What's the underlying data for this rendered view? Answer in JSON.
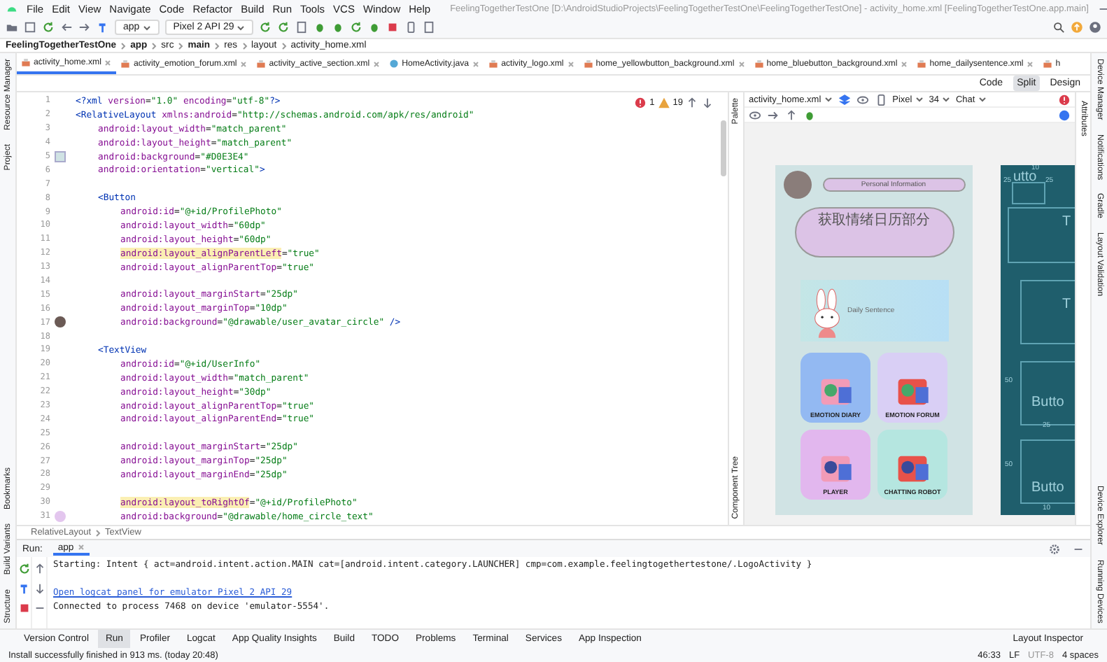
{
  "menu_bar": {
    "items": [
      "File",
      "Edit",
      "View",
      "Navigate",
      "Code",
      "Refactor",
      "Build",
      "Run",
      "Tools",
      "VCS",
      "Window",
      "Help"
    ],
    "title": "FeelingTogetherTestOne [D:\\AndroidStudioProjects\\FeelingTogetherTestOne\\FeelingTogetherTestOne] - activity_home.xml [FeelingTogetherTestOne.app.main]"
  },
  "toolbar": {
    "run_config": "app",
    "device": "Pixel 2 API 29"
  },
  "breadcrumb": [
    "FeelingTogetherTestOne",
    "app",
    "src",
    "main",
    "res",
    "layout",
    "activity_home.xml"
  ],
  "left_strip": {
    "top": [
      "Resource Manager",
      "Project"
    ],
    "bottom": [
      "Bookmarks",
      "Build Variants",
      "Structure"
    ]
  },
  "right_strip": {
    "top": [
      "Device Manager",
      "Notifications",
      "Gradle",
      "Layout Validation"
    ],
    "bottom": [
      "Device Explorer",
      "Running Devices"
    ]
  },
  "editor_tabs": [
    {
      "label": "activity_home.xml",
      "kind": "xml",
      "selected": true
    },
    {
      "label": "activity_emotion_forum.xml",
      "kind": "xml",
      "selected": false
    },
    {
      "label": "activity_active_section.xml",
      "kind": "xml",
      "selected": false
    },
    {
      "label": "HomeActivity.java",
      "kind": "java",
      "selected": false
    },
    {
      "label": "activity_logo.xml",
      "kind": "xml",
      "selected": false
    },
    {
      "label": "home_yellowbutton_background.xml",
      "kind": "xml",
      "selected": false
    },
    {
      "label": "home_bluebutton_background.xml",
      "kind": "xml",
      "selected": false
    },
    {
      "label": "home_dailysentence.xml",
      "kind": "xml",
      "selected": false
    },
    {
      "label": "h",
      "kind": "xml",
      "selected": false
    }
  ],
  "view_modes": [
    {
      "label": "Code",
      "selected": false
    },
    {
      "label": "Split",
      "selected": true
    },
    {
      "label": "Design",
      "selected": false
    }
  ],
  "editor": {
    "errors": "1",
    "warnings": "19",
    "lines": [
      {
        "number": "1",
        "kind": "top",
        "tokens": [
          {
            "kind": "tag",
            "text": "<?xml "
          },
          {
            "kind": "attr",
            "text": "version"
          },
          {
            "kind": "plain",
            "text": "="
          },
          {
            "kind": "value",
            "text": "\"1.0\""
          },
          {
            "kind": "attr",
            "text": " encoding"
          },
          {
            "kind": "plain",
            "text": "="
          },
          {
            "kind": "value",
            "text": "\"utf-8\""
          },
          {
            "kind": "tag",
            "text": "?>"
          }
        ]
      },
      {
        "number": "2",
        "kind": "top",
        "tokens": [
          {
            "kind": "tag",
            "text": "<RelativeLayout "
          },
          {
            "kind": "attr",
            "text": "xmlns:android"
          },
          {
            "kind": "plain",
            "text": "="
          },
          {
            "kind": "value",
            "text": "\"http://schemas.android.com/apk/res/android\""
          }
        ]
      },
      {
        "number": "3",
        "kind": "inner",
        "tokens": [
          {
            "kind": "attr",
            "text": "android:layout_width"
          },
          {
            "kind": "plain",
            "text": "="
          },
          {
            "kind": "value",
            "text": "\"match_parent\""
          }
        ]
      },
      {
        "number": "4",
        "kind": "inner",
        "tokens": [
          {
            "kind": "attr",
            "text": "android:layout_height"
          },
          {
            "kind": "plain",
            "text": "="
          },
          {
            "kind": "value",
            "text": "\"match_parent\""
          }
        ]
      },
      {
        "number": "5",
        "kind": "inner",
        "gutter": {
          "kind": "swatch",
          "color": "#d0e3e4"
        },
        "tokens": [
          {
            "kind": "attr",
            "text": "android:background"
          },
          {
            "kind": "plain",
            "text": "="
          },
          {
            "kind": "value",
            "text": "\"#D0E3E4\""
          }
        ]
      },
      {
        "number": "6",
        "kind": "inner",
        "tokens": [
          {
            "kind": "attr",
            "text": "android:orientation"
          },
          {
            "kind": "plain",
            "text": "="
          },
          {
            "kind": "value",
            "text": "\"vertical\""
          },
          {
            "kind": "tag",
            "text": ">"
          }
        ]
      },
      {
        "number": "7",
        "kind": "blank"
      },
      {
        "number": "8",
        "kind": "inner",
        "tokens": [
          {
            "kind": "tag",
            "text": "<Button"
          }
        ]
      },
      {
        "number": "9",
        "kind": "deep",
        "tokens": [
          {
            "kind": "attr",
            "text": "android:id"
          },
          {
            "kind": "plain",
            "text": "="
          },
          {
            "kind": "value",
            "text": "\"@+id/ProfilePhoto\""
          }
        ]
      },
      {
        "number": "10",
        "kind": "deep",
        "tokens": [
          {
            "kind": "attr",
            "text": "android:layout_width"
          },
          {
            "kind": "plain",
            "text": "="
          },
          {
            "kind": "value",
            "text": "\"60dp\""
          }
        ]
      },
      {
        "number": "11",
        "kind": "deep",
        "tokens": [
          {
            "kind": "attr",
            "text": "android:layout_height"
          },
          {
            "kind": "plain",
            "text": "="
          },
          {
            "kind": "value",
            "text": "\"60dp\""
          }
        ]
      },
      {
        "number": "12",
        "kind": "deep",
        "tokens": [
          {
            "kind": "attr_warning",
            "text": "android:layout_alignParentLeft"
          },
          {
            "kind": "plain",
            "text": "="
          },
          {
            "kind": "value",
            "text": "\"true\""
          }
        ]
      },
      {
        "number": "13",
        "kind": "deep",
        "tokens": [
          {
            "kind": "attr",
            "text": "android:layout_alignParentTop"
          },
          {
            "kind": "plain",
            "text": "="
          },
          {
            "kind": "value",
            "text": "\"true\""
          }
        ]
      },
      {
        "number": "14",
        "kind": "blank"
      },
      {
        "number": "15",
        "kind": "deep",
        "tokens": [
          {
            "kind": "attr",
            "text": "android:layout_marginStart"
          },
          {
            "kind": "plain",
            "text": "="
          },
          {
            "kind": "value",
            "text": "\"25dp\""
          }
        ]
      },
      {
        "number": "16",
        "kind": "deep",
        "tokens": [
          {
            "kind": "attr",
            "text": "android:layout_marginTop"
          },
          {
            "kind": "plain",
            "text": "="
          },
          {
            "kind": "value",
            "text": "\"10dp\""
          }
        ]
      },
      {
        "number": "17",
        "kind": "deep",
        "gutter": {
          "kind": "avatar",
          "color": "#6b5a55"
        },
        "tokens": [
          {
            "kind": "attr",
            "text": "android:background"
          },
          {
            "kind": "plain",
            "text": "="
          },
          {
            "kind": "value",
            "text": "\"@drawable/user_avatar_circle\""
          },
          {
            "kind": "tag",
            "text": " />"
          }
        ]
      },
      {
        "number": "18",
        "kind": "blank"
      },
      {
        "number": "19",
        "kind": "inner",
        "tokens": [
          {
            "kind": "tag",
            "text": "<TextView"
          }
        ]
      },
      {
        "number": "20",
        "kind": "deep",
        "tokens": [
          {
            "kind": "attr",
            "text": "android:id"
          },
          {
            "kind": "plain",
            "text": "="
          },
          {
            "kind": "value",
            "text": "\"@+id/UserInfo\""
          }
        ]
      },
      {
        "number": "21",
        "kind": "deep",
        "tokens": [
          {
            "kind": "attr",
            "text": "android:layout_width"
          },
          {
            "kind": "plain",
            "text": "="
          },
          {
            "kind": "value",
            "text": "\"match_parent\""
          }
        ]
      },
      {
        "number": "22",
        "kind": "deep",
        "tokens": [
          {
            "kind": "attr",
            "text": "android:layout_height"
          },
          {
            "kind": "plain",
            "text": "="
          },
          {
            "kind": "value",
            "text": "\"30dp\""
          }
        ]
      },
      {
        "number": "23",
        "kind": "deep",
        "tokens": [
          {
            "kind": "attr",
            "text": "android:layout_alignParentTop"
          },
          {
            "kind": "plain",
            "text": "="
          },
          {
            "kind": "value",
            "text": "\"true\""
          }
        ]
      },
      {
        "number": "24",
        "kind": "deep",
        "tokens": [
          {
            "kind": "attr",
            "text": "android:layout_alignParentEnd"
          },
          {
            "kind": "plain",
            "text": "="
          },
          {
            "kind": "value",
            "text": "\"true\""
          }
        ]
      },
      {
        "number": "25",
        "kind": "blank"
      },
      {
        "number": "26",
        "kind": "deep",
        "tokens": [
          {
            "kind": "attr",
            "text": "android:layout_marginStart"
          },
          {
            "kind": "plain",
            "text": "="
          },
          {
            "kind": "value",
            "text": "\"25dp\""
          }
        ]
      },
      {
        "number": "27",
        "kind": "deep",
        "tokens": [
          {
            "kind": "attr",
            "text": "android:layout_marginTop"
          },
          {
            "kind": "plain",
            "text": "="
          },
          {
            "kind": "value",
            "text": "\"25dp\""
          }
        ]
      },
      {
        "number": "28",
        "kind": "deep",
        "tokens": [
          {
            "kind": "attr",
            "text": "android:layout_marginEnd"
          },
          {
            "kind": "plain",
            "text": "="
          },
          {
            "kind": "value",
            "text": "\"25dp\""
          }
        ]
      },
      {
        "number": "29",
        "kind": "blank"
      },
      {
        "number": "30",
        "kind": "deep",
        "tokens": [
          {
            "kind": "attr_warning",
            "text": "android:layout_toRightOf"
          },
          {
            "kind": "plain",
            "text": "="
          },
          {
            "kind": "value",
            "text": "\"@+id/ProfilePhoto\""
          }
        ]
      },
      {
        "number": "31",
        "kind": "deep",
        "gutter": {
          "kind": "circle",
          "color": "#e3c6ee"
        },
        "tokens": [
          {
            "kind": "attr",
            "text": "android:background"
          },
          {
            "kind": "plain",
            "text": "="
          },
          {
            "kind": "value",
            "text": "\"@drawable/home_circle_text\""
          }
        ]
      }
    ]
  },
  "design": {
    "palette_label": "Palette",
    "tree_label": "Component Tree",
    "attributes_label": "Attributes",
    "file": "activity_home.xml",
    "device": "Pixel",
    "api": "34",
    "theme": "Chat"
  },
  "preview": {
    "profile_label": "Personal Information",
    "calendar_label": "获取情绪日历部分",
    "daily_label": "Daily Sentence",
    "tiles": [
      {
        "label": "EMOTION DIARY",
        "color": "#93b9f2"
      },
      {
        "label": "EMOTION FORUM",
        "color": "#d9cff5"
      },
      {
        "label": "PLAYER",
        "color": "#e2b7ee"
      },
      {
        "label": "CHATTING ROBOT",
        "color": "#b5e6e0"
      }
    ]
  },
  "blueprint": {
    "items": [
      {
        "kind": "margin",
        "text": "10"
      },
      {
        "kind": "margin",
        "text": "25"
      },
      {
        "kind": "widget",
        "text": "utto"
      },
      {
        "kind": "margin",
        "text": "25"
      },
      {
        "kind": "widget",
        "text": "T"
      },
      {
        "kind": "widget",
        "text": "T"
      },
      {
        "kind": "margin",
        "text": "50"
      },
      {
        "kind": "widget",
        "text": "Butto"
      },
      {
        "kind": "margin",
        "text": "25"
      },
      {
        "kind": "margin",
        "text": "50"
      },
      {
        "kind": "widget",
        "text": "Butto"
      },
      {
        "kind": "margin",
        "text": "10"
      }
    ]
  },
  "editor_breadcrumb": [
    "RelativeLayout",
    "TextView"
  ],
  "run": {
    "label": "Run:",
    "tab": "app",
    "console": [
      {
        "kind": "text",
        "text": "Starting: Intent { act=android.intent.action.MAIN cat=[android.intent.category.LAUNCHER] cmp=com.example.feelingtogethertestone/.LogoActivity }"
      },
      {
        "kind": "blank"
      },
      {
        "kind": "link",
        "text": "Open logcat panel for emulator Pixel 2 API 29"
      },
      {
        "kind": "text",
        "text": "Connected to process 7468 on device 'emulator-5554'."
      }
    ]
  },
  "tool_tabs": [
    {
      "label": "Version Control",
      "selected": false
    },
    {
      "label": "Run",
      "selected": true
    },
    {
      "label": "Profiler",
      "selected": false
    },
    {
      "label": "Logcat",
      "selected": false
    },
    {
      "label": "App Quality Insights",
      "selected": false
    },
    {
      "label": "Build",
      "selected": false
    },
    {
      "label": "TODO",
      "selected": false
    },
    {
      "label": "Problems",
      "selected": false
    },
    {
      "label": "Terminal",
      "selected": false
    },
    {
      "label": "Services",
      "selected": false
    },
    {
      "label": "App Inspection",
      "selected": false
    }
  ],
  "layout_inspector": "Layout Inspector",
  "status_bar": {
    "message": "Install successfully finished in 913 ms. (today 20:48)",
    "position": "46:33",
    "line_ending": "LF",
    "encoding": "UTF-8",
    "indent": "4 spaces"
  }
}
